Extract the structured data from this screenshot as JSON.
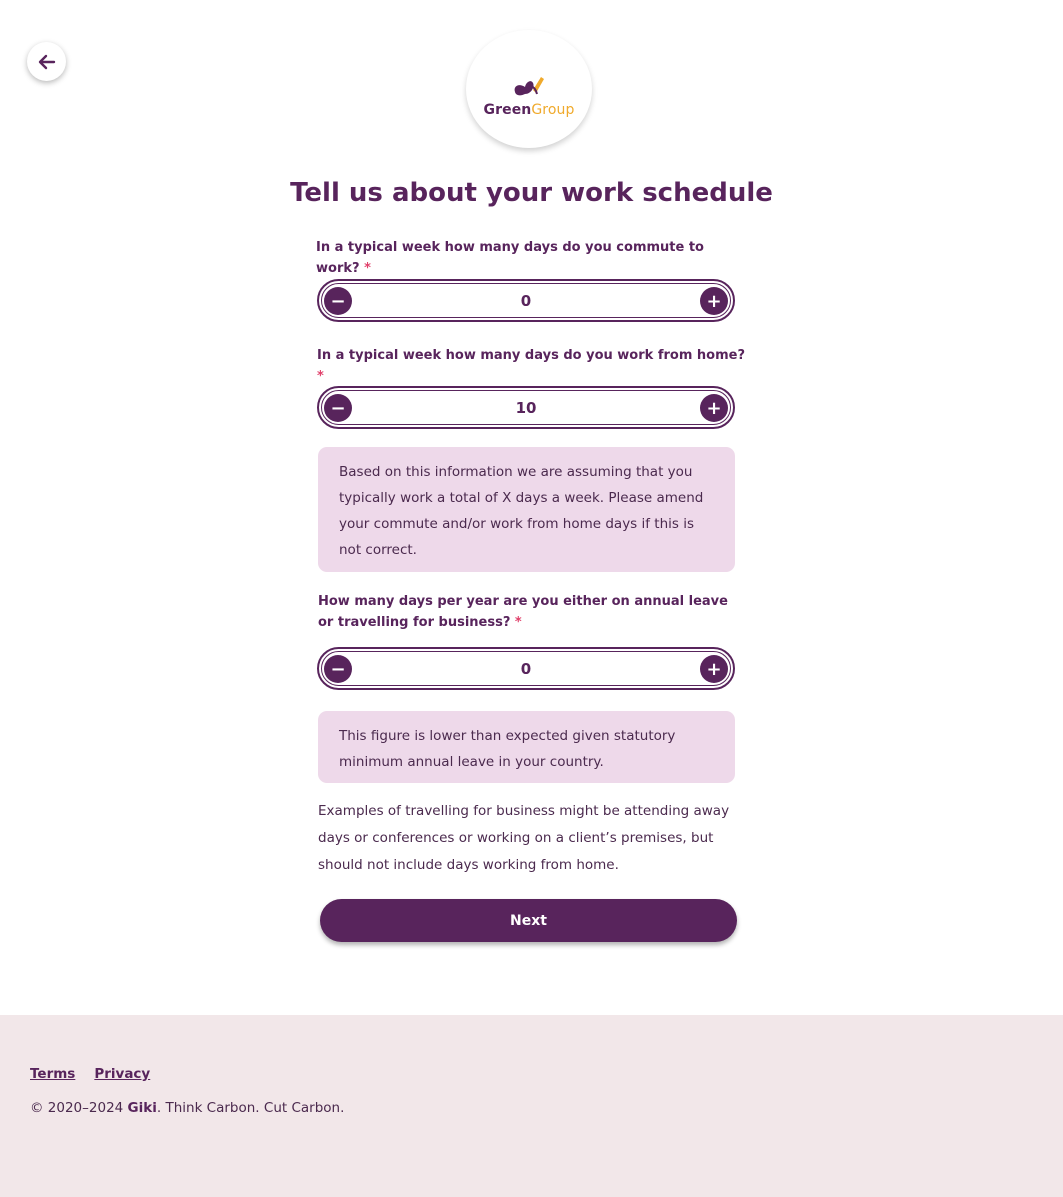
{
  "header": {
    "back_icon": "arrow-left-icon",
    "logo": {
      "part1": "Green",
      "part2": "Group",
      "colors": {
        "primary": "#58245c",
        "accent": "#f0aa2c"
      }
    }
  },
  "title": "Tell us about your work schedule",
  "questions": [
    {
      "label": "In a typical week how many days do you commute to work?",
      "required": "*",
      "value": "0"
    },
    {
      "label": "In a typical week how many days do you work from home?",
      "required": "*",
      "value": "10"
    },
    {
      "label": "How many days per year are you either on annual leave or travelling for business?",
      "required": "*",
      "value": "0"
    }
  ],
  "info_boxes": [
    "Based on this information we are assuming that you typically work a total of X days a week. Please amend your commute and/or work from home days if this is not correct.",
    "This figure is lower than expected given statutory minimum annual leave in your country."
  ],
  "help_text": "Examples of travelling for business might be attending away days or conferences or working on a client’s premises, but should not include days working from home.",
  "stepper": {
    "minus": "−",
    "plus": "+"
  },
  "next_label": "Next",
  "footer": {
    "links": [
      "Terms",
      "Privacy"
    ],
    "copyright_prefix": "© 2020–2024 ",
    "brand": "Giki",
    "copyright_suffix": ". Think Carbon. Cut Carbon."
  },
  "colors": {
    "primary": "#58245c",
    "info_bg": "#eed9ea",
    "footer_bg": "#f2e7e9",
    "required": "#e0406a"
  }
}
